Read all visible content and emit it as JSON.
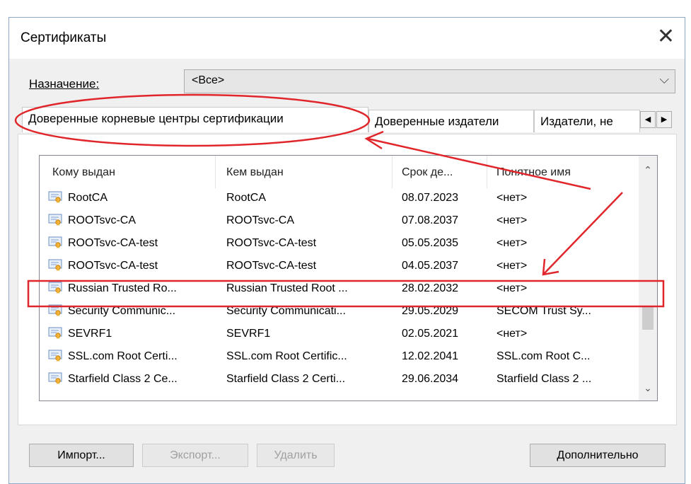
{
  "dialog": {
    "title": "Сертификаты"
  },
  "purpose": {
    "label": "Назначение:",
    "selected": "<Все>"
  },
  "tabs": [
    {
      "label": "Доверенные корневые центры сертификации"
    },
    {
      "label": "Доверенные издатели"
    },
    {
      "label": "Издатели, не"
    }
  ],
  "list": {
    "columns": [
      "Кому выдан",
      "Кем выдан",
      "Срок де...",
      "Понятное имя"
    ],
    "rows": [
      {
        "issued_to": "RootCA",
        "issued_by": "RootCA",
        "expires": "08.07.2023",
        "friendly": "<нет>"
      },
      {
        "issued_to": "ROOTsvc-CA",
        "issued_by": "ROOTsvc-CA",
        "expires": "07.08.2037",
        "friendly": "<нет>"
      },
      {
        "issued_to": "ROOTsvc-CA-test",
        "issued_by": "ROOTsvc-CA-test",
        "expires": "05.05.2035",
        "friendly": "<нет>"
      },
      {
        "issued_to": "ROOTsvc-CA-test",
        "issued_by": "ROOTsvc-CA-test",
        "expires": "04.05.2037",
        "friendly": "<нет>"
      },
      {
        "issued_to": "Russian Trusted Ro...",
        "issued_by": "Russian Trusted Root ...",
        "expires": "28.02.2032",
        "friendly": "<нет>"
      },
      {
        "issued_to": "Security Communic...",
        "issued_by": "Security Communicati...",
        "expires": "29.05.2029",
        "friendly": "SECOM Trust Sy..."
      },
      {
        "issued_to": "SEVRF1",
        "issued_by": "SEVRF1",
        "expires": "02.05.2021",
        "friendly": "<нет>"
      },
      {
        "issued_to": "SSL.com Root Certi...",
        "issued_by": "SSL.com Root Certific...",
        "expires": "12.02.2041",
        "friendly": "SSL.com Root C..."
      },
      {
        "issued_to": "Starfield Class 2 Ce...",
        "issued_by": "Starfield Class 2 Certi...",
        "expires": "29.06.2034",
        "friendly": "Starfield Class 2 ..."
      }
    ]
  },
  "buttons": {
    "import": "Импорт...",
    "export": "Экспорт...",
    "delete": "Удалить",
    "advanced": "Дополнительно"
  },
  "icons": {
    "close": "close-icon",
    "dropdown": "chevron-down-icon",
    "certificate": "certificate-icon"
  },
  "colors": {
    "annotation": "#e0262b",
    "accent_border": "#8ea7c6"
  }
}
